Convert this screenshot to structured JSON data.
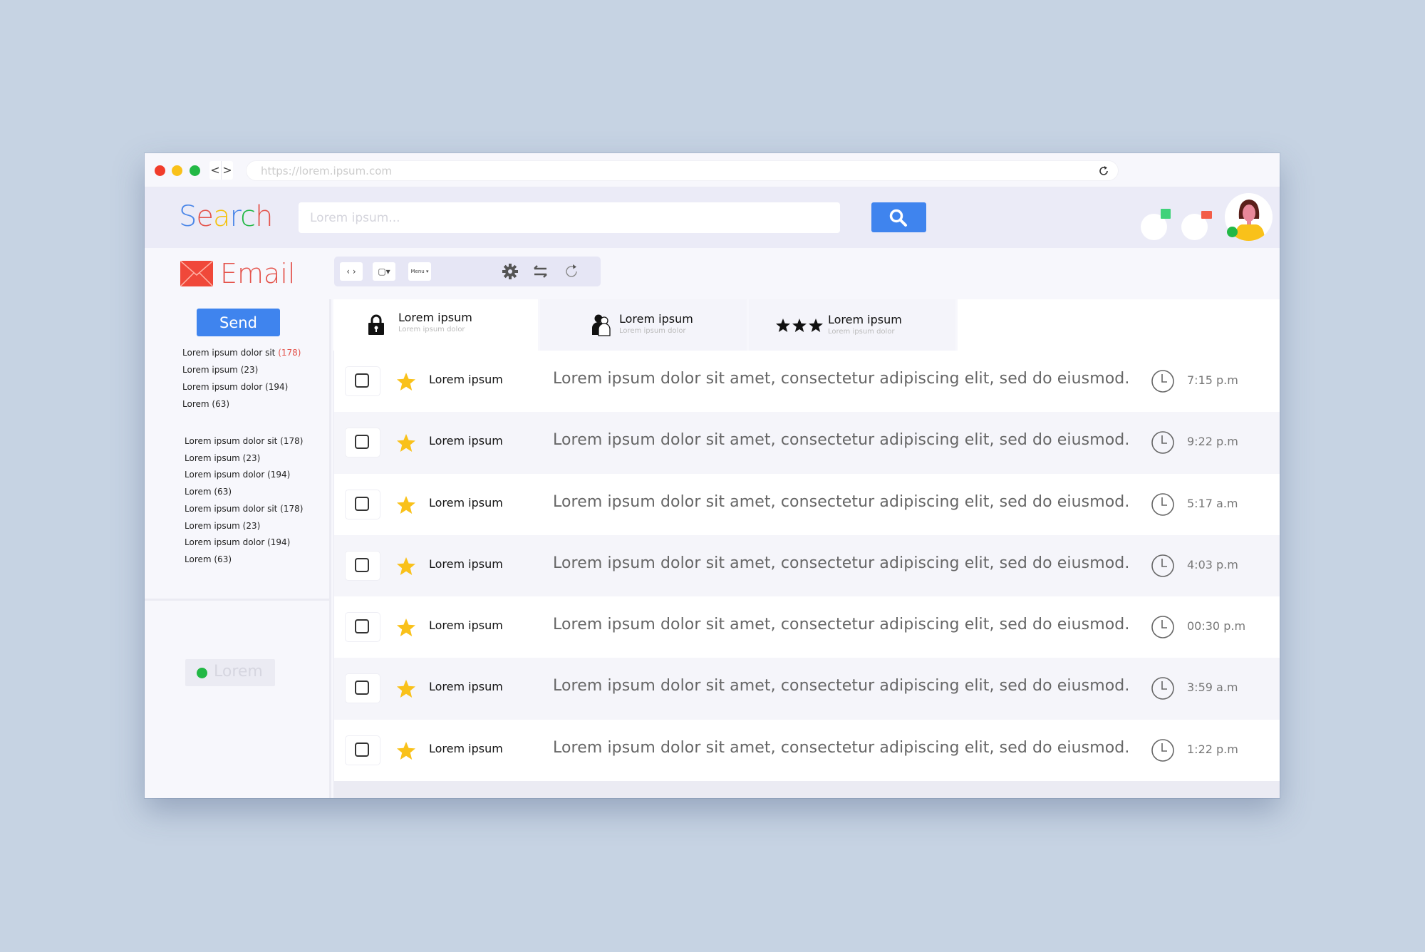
{
  "browser": {
    "url": "https://lorem.ipsum.com",
    "back_label": "<",
    "forward_label": ">"
  },
  "header": {
    "brand_letters": [
      {
        "char": "S",
        "color": "#4a86e8"
      },
      {
        "char": "e",
        "color": "#e4534b"
      },
      {
        "char": "a",
        "color": "#f4c20d"
      },
      {
        "char": "r",
        "color": "#4a86e8"
      },
      {
        "char": "c",
        "color": "#22b845"
      },
      {
        "char": "h",
        "color": "#e4534b"
      }
    ],
    "search_placeholder": "Lorem ipsum...",
    "search_button_icon": "search-icon",
    "accent": "#3f84ee"
  },
  "email": {
    "title": "Email",
    "title_color": "#e4534b",
    "toolbar": {
      "nav_label": "‹ ›",
      "select_label": "▢▾",
      "menu_label": "Menu ▾",
      "icons": [
        "gear-icon",
        "swap-icon",
        "refresh-icon"
      ]
    }
  },
  "sidebar": {
    "send_label": "Send",
    "primary_folders": [
      {
        "label": "Lorem ipsum dolor sit",
        "count": "(178)",
        "highlight": true
      },
      {
        "label": "Lorem ipsum",
        "count": "(23)",
        "highlight": false
      },
      {
        "label": "Lorem ipsum dolor",
        "count": "(194)",
        "highlight": false
      },
      {
        "label": "Lorem",
        "count": "(63)",
        "highlight": false
      }
    ],
    "secondary_folders": [
      "Lorem ipsum dolor sit (178)",
      "Lorem ipsum (23)",
      "Lorem ipsum dolor (194)",
      "Lorem (63)",
      "Lorem ipsum dolor sit (178)",
      "Lorem ipsum (23)",
      "Lorem ipsum dolor (194)",
      "Lorem (63)"
    ],
    "status_label": "Lorem",
    "status_color": "#22b845"
  },
  "tabs": [
    {
      "title": "Lorem ipsum",
      "subtitle": "Lorem ipsum dolor",
      "icon": "lock-icon",
      "active": true
    },
    {
      "title": "Lorem ipsum",
      "subtitle": "Lorem ipsum dolor",
      "icon": "people-icon",
      "active": false
    },
    {
      "title": "Lorem ipsum",
      "subtitle": "Lorem ipsum dolor",
      "icon": "three-stars-icon",
      "active": false
    }
  ],
  "messages": [
    {
      "sender": "Lorem ipsum",
      "subject": "Lorem ipsum dolor sit amet, consectetur adipiscing elit, sed do eiusmod.",
      "time": "7:15 p.m",
      "starred": true,
      "checked": false
    },
    {
      "sender": "Lorem ipsum",
      "subject": "Lorem ipsum dolor sit amet, consectetur adipiscing elit, sed do eiusmod.",
      "time": "9:22 p.m",
      "starred": true,
      "checked": false
    },
    {
      "sender": "Lorem ipsum",
      "subject": "Lorem ipsum dolor sit amet, consectetur adipiscing elit, sed do eiusmod.",
      "time": "5:17 a.m",
      "starred": true,
      "checked": false
    },
    {
      "sender": "Lorem ipsum",
      "subject": "Lorem ipsum dolor sit amet, consectetur adipiscing elit, sed do eiusmod.",
      "time": "4:03 p.m",
      "starred": true,
      "checked": false
    },
    {
      "sender": "Lorem ipsum",
      "subject": "Lorem ipsum dolor sit amet, consectetur adipiscing elit, sed do eiusmod.",
      "time": "00:30 p.m",
      "starred": true,
      "checked": false
    },
    {
      "sender": "Lorem ipsum",
      "subject": "Lorem ipsum dolor sit amet, consectetur adipiscing elit, sed do eiusmod.",
      "time": "3:59 a.m",
      "starred": true,
      "checked": false
    },
    {
      "sender": "Lorem ipsum",
      "subject": "Lorem ipsum dolor sit amet, consectetur adipiscing elit, sed do eiusmod.",
      "time": "1:22 p.m",
      "starred": true,
      "checked": false
    }
  ],
  "colors": {
    "star": "#f9c11a",
    "background": "#c6d3e3"
  }
}
